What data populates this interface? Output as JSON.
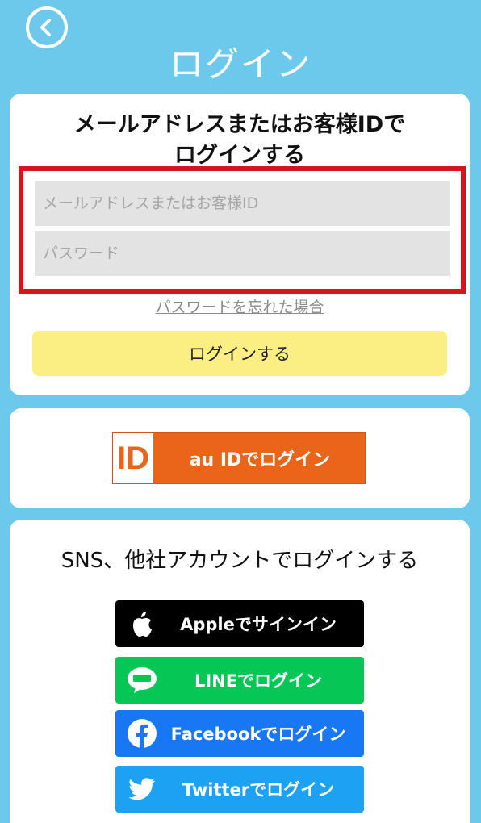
{
  "header": {
    "title": "ログイン",
    "back_icon": "chevron-left-circle-icon"
  },
  "login_card": {
    "heading_line1": "メールアドレスまたはお客様IDで",
    "heading_line2": "ログインする",
    "email_placeholder": "メールアドレスまたはお客様ID",
    "password_placeholder": "パスワード",
    "forgot_link": "パスワードを忘れた場合",
    "login_button": "ログインする",
    "highlight_color": "#d7131f",
    "button_color": "#fbef84"
  },
  "auid_card": {
    "logo_text": "ID",
    "button_label": "au IDでログイン",
    "button_color": "#ea6419"
  },
  "sns_card": {
    "heading": "SNS、他社アカウントでログインする",
    "buttons": [
      {
        "label": "Appleでサインイン",
        "icon": "apple-icon",
        "color": "#000000"
      },
      {
        "label": "LINEでログイン",
        "icon": "line-icon",
        "color": "#06c755"
      },
      {
        "label": "Facebookでログイン",
        "icon": "facebook-icon",
        "color": "#1877f2"
      },
      {
        "label": "Twitterでログイン",
        "icon": "twitter-icon",
        "color": "#1da1f2"
      }
    ]
  },
  "background_color": "#6cc9ec"
}
